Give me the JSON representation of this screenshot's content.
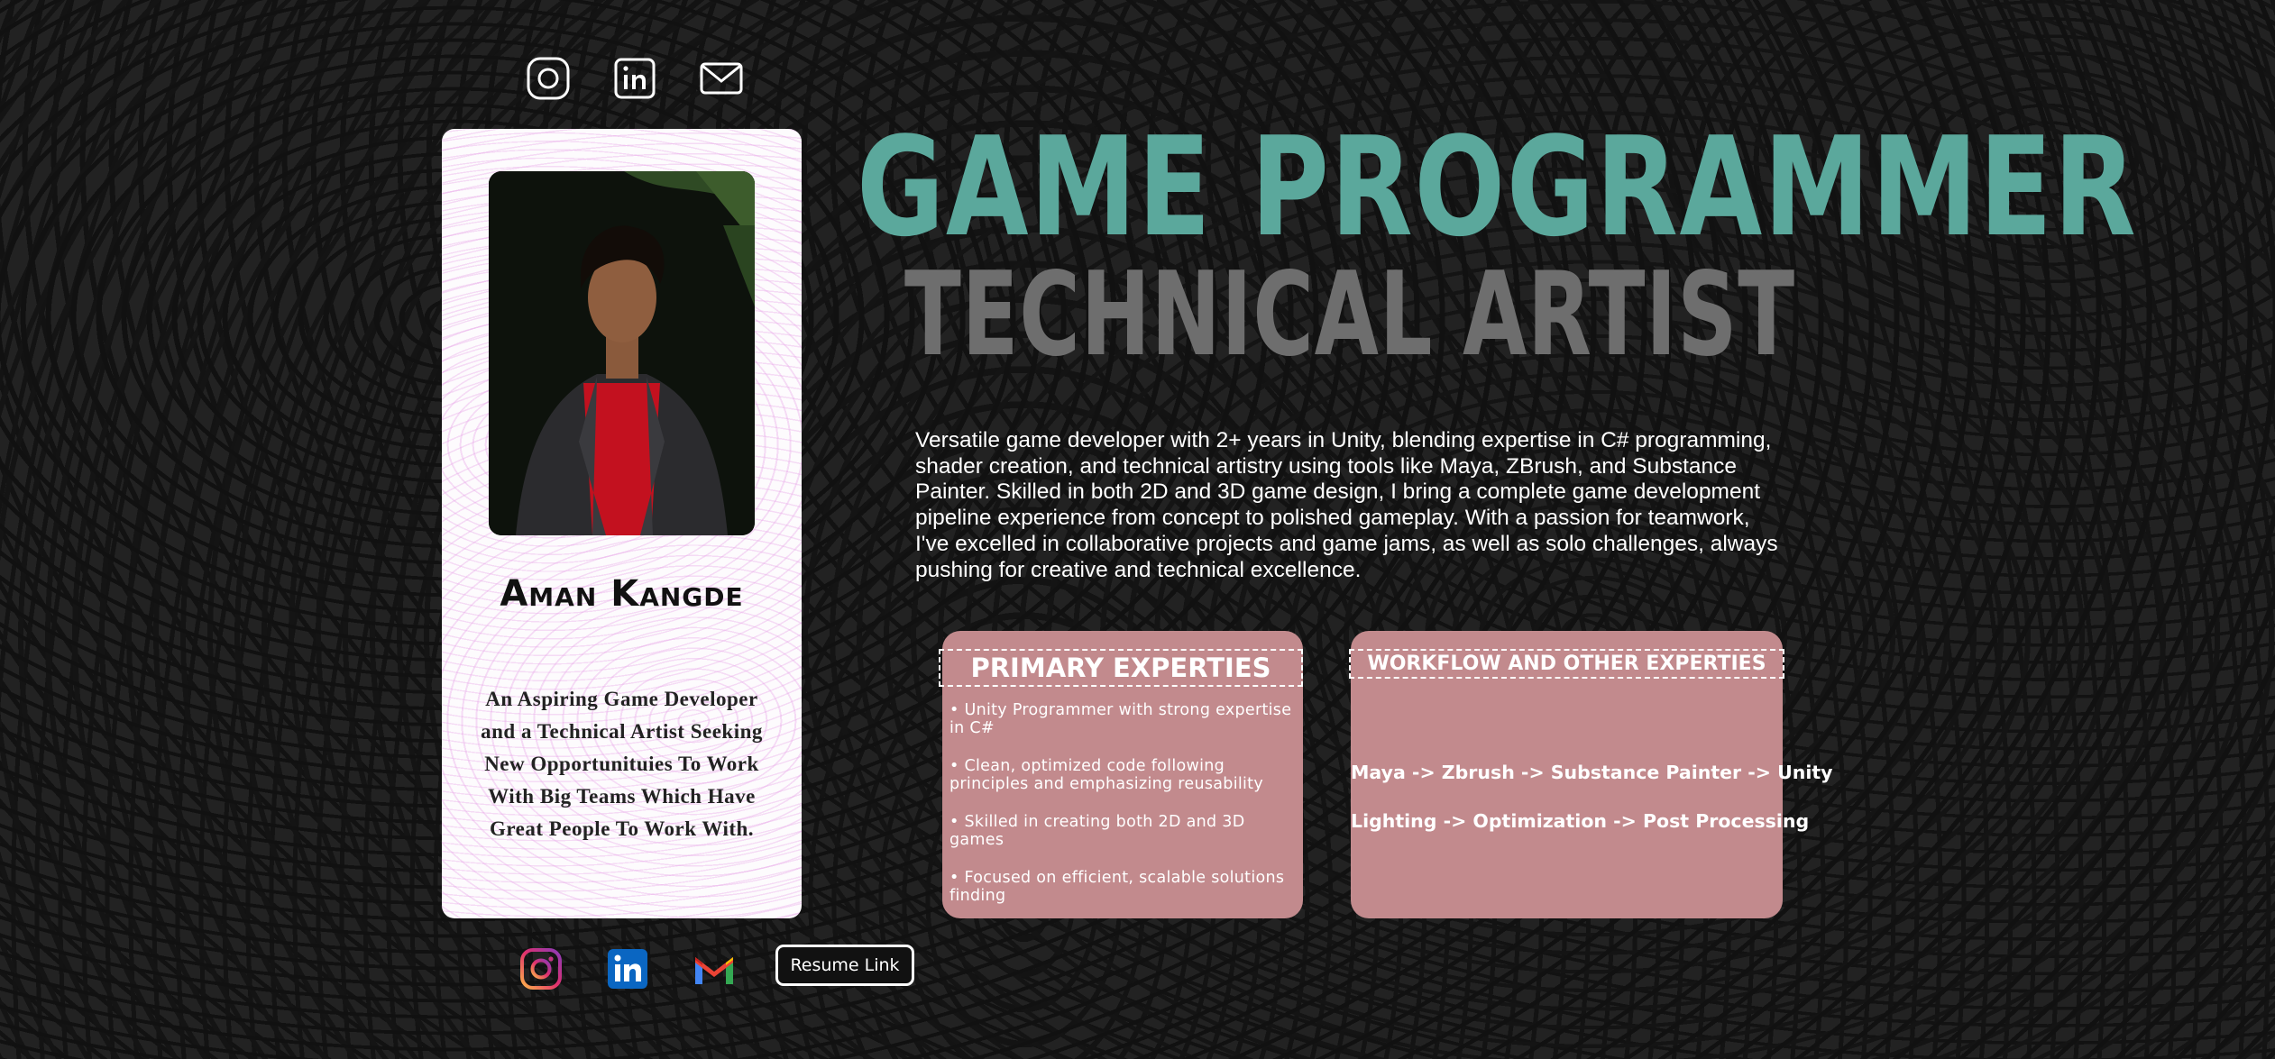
{
  "icons": {
    "top": [
      "instagram-outline-icon",
      "linkedin-outline-icon",
      "mail-outline-icon"
    ],
    "bottom": [
      "instagram-icon",
      "linkedin-icon",
      "gmail-icon"
    ]
  },
  "profile": {
    "name": "Aman Kangde",
    "tagline": "An Aspiring Game Developer and a Technical Artist Seeking New Opportunituies To Work With Big Teams Which Have Great People To Work With."
  },
  "headings": {
    "title": "GAME PROGRAMMER",
    "subtitle": "TECHNICAL ARTIST"
  },
  "bio": "Versatile game developer with 2+ years in Unity, blending expertise in C# programming, shader creation, and technical artistry using tools like Maya, ZBrush, and Substance Painter. Skilled in both 2D and 3D game design, I bring a complete game development pipeline experience from concept to polished gameplay. With a passion for teamwork, I've excelled in collaborative projects and game jams, as well as solo challenges, always pushing for creative and technical excellence.",
  "primary": {
    "heading": "PRIMARY EXPERTIES",
    "items": [
      "• Unity Programmer with strong expertise in C#",
      "• Clean, optimized code following principles and emphasizing reusability",
      "• Skilled in creating both 2D and 3D games",
      "• Focused on efficient, scalable solutions finding"
    ]
  },
  "workflow": {
    "heading": "WORKFLOW AND OTHER EXPERTIES",
    "line1": "Maya -> Zbrush -> Substance Painter -> Unity",
    "line2": "Lighting -> Optimization -> Post Processing"
  },
  "resume_label": "Resume Link",
  "colors": {
    "accent_teal": "#5ba89c",
    "subtitle_gray": "#6e6e6e",
    "box_rose": "#c28a8d",
    "card_bg": "#fdfbfd"
  }
}
